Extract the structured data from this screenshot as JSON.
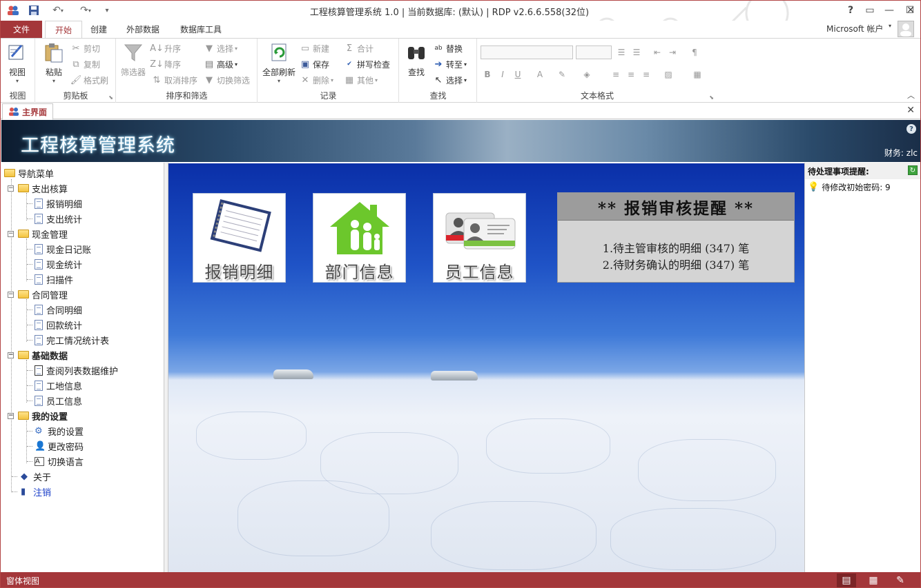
{
  "window": {
    "title": "工程核算管理系统 1.0 | 当前数据库: (默认) | RDP v2.6.6.558(32位)",
    "help": "?",
    "account": "Microsoft 帐户"
  },
  "ribbon_tabs": [
    "文件",
    "开始",
    "创建",
    "外部数据",
    "数据库工具"
  ],
  "ribbon": {
    "view": {
      "label": "视图",
      "group": "视图"
    },
    "clipboard": {
      "paste": "粘贴",
      "cut": "剪切",
      "copy": "复制",
      "format_painter": "格式刷",
      "group": "剪贴板"
    },
    "sort_filter": {
      "filter": "筛选器",
      "ascending": "升序",
      "descending": "降序",
      "remove_sort": "取消排序",
      "selection": "选择",
      "advanced": "高级",
      "toggle_filter": "切换筛选",
      "group": "排序和筛选"
    },
    "records": {
      "refresh_all": "全部刷新",
      "new": "新建",
      "save": "保存",
      "delete": "删除",
      "totals": "合计",
      "spelling": "拼写检查",
      "more": "其他",
      "group": "记录"
    },
    "find": {
      "find": "查找",
      "replace": "替换",
      "goto": "转至",
      "select": "选择",
      "group": "查找"
    },
    "text_format": {
      "group": "文本格式",
      "bold": "B",
      "italic": "I",
      "underline": "U"
    }
  },
  "doc_tab": {
    "label": "主界面"
  },
  "banner": {
    "title": "工程核算管理系统",
    "user": "财务: zlc"
  },
  "nav": {
    "root": "导航菜单",
    "groups": [
      {
        "label": "支出核算",
        "items": [
          "报销明细",
          "支出统计"
        ]
      },
      {
        "label": "现金管理",
        "items": [
          "现金日记账",
          "现金统计",
          "扫描件"
        ]
      },
      {
        "label": "合同管理",
        "items": [
          "合同明细",
          "回款统计",
          "完工情况统计表"
        ]
      },
      {
        "label": "基础数据",
        "items": [
          "查阅列表数据维护",
          "工地信息",
          "员工信息"
        ]
      },
      {
        "label": "我的设置",
        "items": [
          "我的设置",
          "更改密码",
          "切换语言"
        ]
      }
    ],
    "about": "关于",
    "logout": "注销"
  },
  "tiles": [
    {
      "label": "报销明细",
      "icon": "notebook-icon"
    },
    {
      "label": "部门信息",
      "icon": "house-family-icon"
    },
    {
      "label": "员工信息",
      "icon": "id-cards-icon"
    }
  ],
  "notice": {
    "title": "** 报销审核提醒 **",
    "lines": [
      "1.待主管审核的明细 (347) 笔",
      "2.待财务确认的明细 (347) 笔"
    ]
  },
  "pending": {
    "title": "待处理事项提醒:",
    "item": "待修改初始密码: 9"
  },
  "status": {
    "text": "窗体视图"
  },
  "colors": {
    "accent": "#a4373a"
  }
}
